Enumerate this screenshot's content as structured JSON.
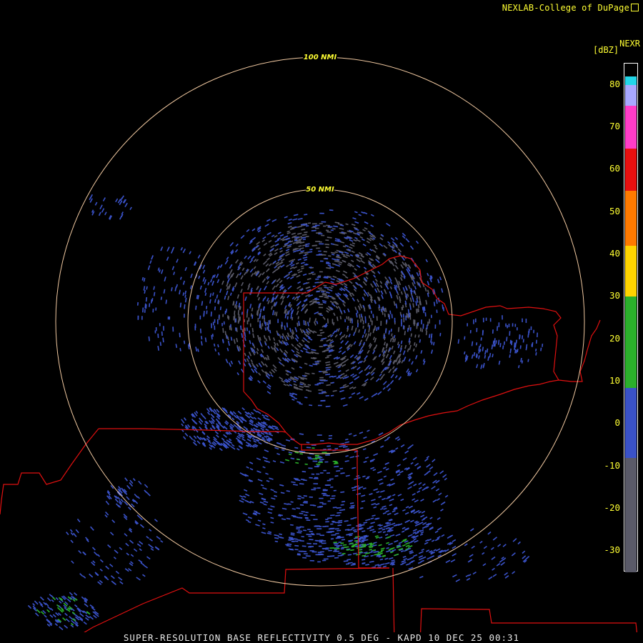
{
  "header": {
    "credit": "NEXLAB-College of DuPage",
    "product": "NEXR",
    "units": "[dBZ]"
  },
  "footer": {
    "title": "SUPER-RESOLUTION BASE REFLECTIVITY 0.5 DEG - KAPD 10 DEC 25 00:31"
  },
  "range_rings": [
    {
      "label": "100 NMI",
      "range_nmi": 100
    },
    {
      "label": "50 NMI",
      "range_nmi": 50
    }
  ],
  "color_scale": {
    "labels": [
      "80",
      "70",
      "60",
      "50",
      "40",
      "30",
      "20",
      "10",
      "0",
      "-10",
      "-20",
      "-30"
    ],
    "values": [
      80,
      70,
      60,
      50,
      40,
      30,
      20,
      10,
      0,
      -10,
      -20,
      -30
    ],
    "range": [
      -35,
      85
    ],
    "bands": [
      {
        "from": -35,
        "to": -8,
        "color": "#5a5a68"
      },
      {
        "from": -8,
        "to": 8.5,
        "color": "#3a52c8"
      },
      {
        "from": 8.5,
        "to": 30,
        "color": "#2bb02b"
      },
      {
        "from": 30,
        "to": 42,
        "color": "#ffd400"
      },
      {
        "from": 42,
        "to": 55,
        "color": "#ff7a00"
      },
      {
        "from": 55,
        "to": 65,
        "color": "#e81010"
      },
      {
        "from": 65,
        "to": 75,
        "color": "#ff3cc8"
      },
      {
        "from": 75,
        "to": 80,
        "color": "#a8a8ff"
      },
      {
        "from": 80,
        "to": 82,
        "color": "#22d6e8"
      }
    ]
  },
  "colors": {
    "ring": "#f0c8a0",
    "border": "#e01010",
    "label": "#ffff33",
    "echo_low": "#5a5a68",
    "echo_blue": "#3a52c8",
    "echo_green": "#2bb02b"
  }
}
